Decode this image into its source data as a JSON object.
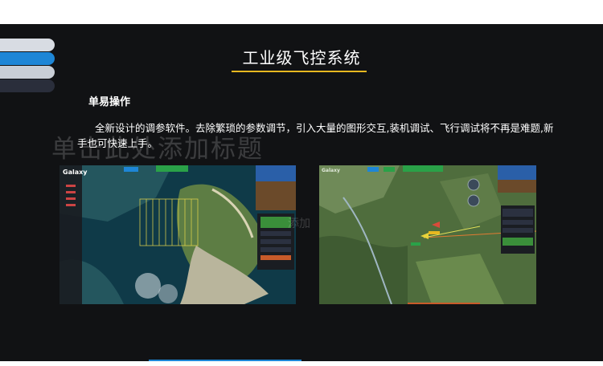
{
  "slide": {
    "title": "工业级飞控系统",
    "section_heading": "单易操作",
    "body": "全新设计的调参软件。去除繁琐的参数调节，引入大量的图形交互,装机调试、飞行调试将不再是难题,新手也可快速上手。",
    "placeholder_ghost": "单击此处添加标题",
    "placeholder_ghost_2": "添加"
  },
  "screenshots": {
    "left_logo": "Galaxy",
    "right_logo": "Galaxy"
  },
  "colors": {
    "accent_gold": "#e8b820",
    "accent_blue": "#1e86d6",
    "background": "#111214"
  }
}
